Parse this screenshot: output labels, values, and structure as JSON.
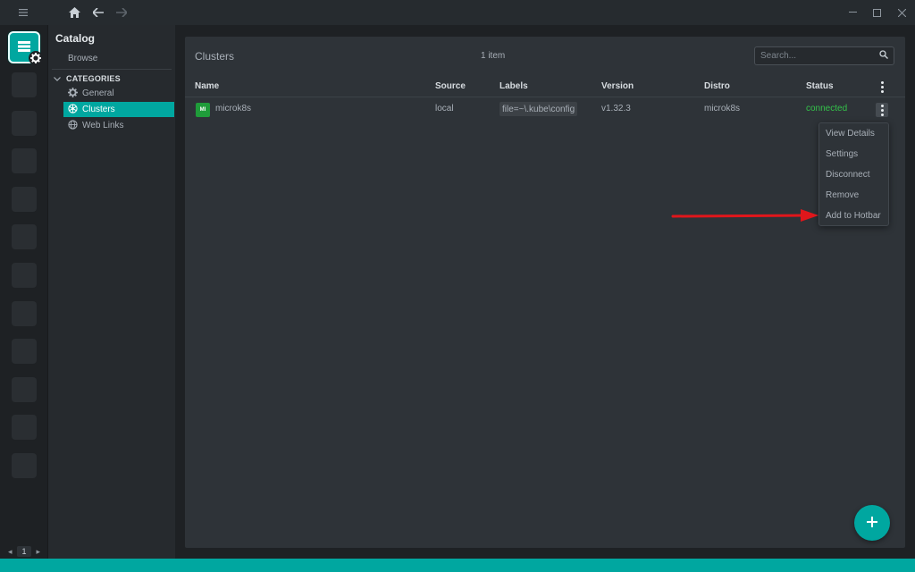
{
  "titlebar": {
    "icons": [
      "menu-icon",
      "home-icon",
      "back-icon",
      "forward-icon",
      "minimize-icon",
      "maximize-icon",
      "close-icon"
    ]
  },
  "hotbar": {
    "active_icon": "catalog-icon",
    "badge_icon": "gear-icon",
    "empty_slots": 11,
    "pager": {
      "current": "1"
    }
  },
  "sidebar": {
    "title": "Catalog",
    "browse_label": "Browse",
    "categories_label": "CATEGORIES",
    "items": [
      {
        "label": "General",
        "icon": "gear-icon",
        "active": false
      },
      {
        "label": "Clusters",
        "icon": "kubernetes-icon",
        "active": true
      },
      {
        "label": "Web Links",
        "icon": "globe-icon",
        "active": false
      }
    ]
  },
  "main": {
    "title": "Clusters",
    "count": "1 item",
    "search": {
      "placeholder": "Search...",
      "value": ""
    },
    "columns": [
      "Name",
      "Source",
      "Labels",
      "Version",
      "Distro",
      "Status"
    ],
    "rows": [
      {
        "avatar": "MI",
        "name": "microk8s",
        "source": "local",
        "labels": "file=~\\.kube\\config",
        "version": "v1.32.3",
        "distro": "microk8s",
        "status": "connected"
      }
    ]
  },
  "context_menu": {
    "items": [
      "View Details",
      "Settings",
      "Disconnect",
      "Remove",
      "Add to Hotbar"
    ]
  },
  "fab": {
    "icon": "plus-icon"
  },
  "colors": {
    "accent": "#00a7a0",
    "status_connected": "#34c24a",
    "annotation": "#e0161b",
    "background": "#1e2124",
    "panel": "#2e3338"
  }
}
